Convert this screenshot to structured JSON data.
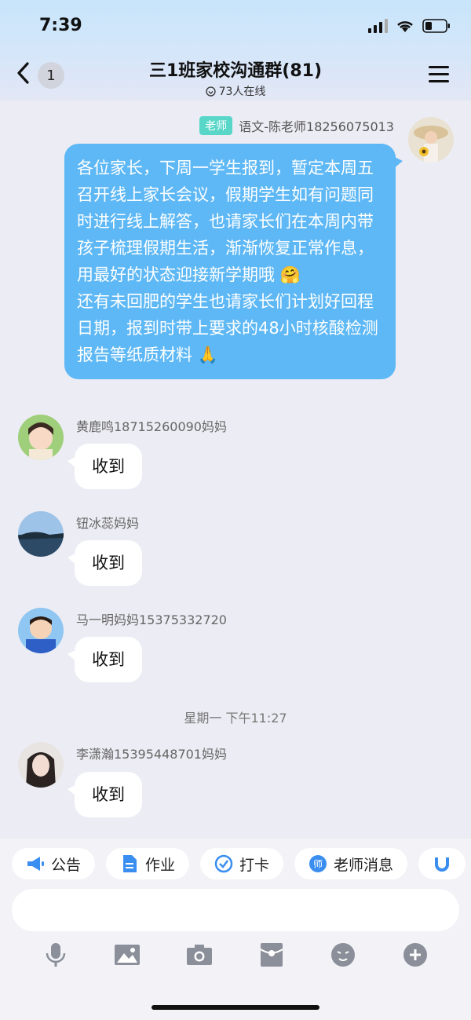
{
  "status": {
    "time": "7:39"
  },
  "header": {
    "back_badge": "1",
    "title": "三1班家校沟通群(81)",
    "online": "73人在线"
  },
  "teacher_message": {
    "tag": "老师",
    "sender": "语文-陈老师18256075013",
    "paragraphs": [
      "各位家长，下周一学生报到，暂定本周五召开线上家长会议，假期学生如有问题同时进行线上解答，也请家长们在本周内带孩子梳理假期生活，渐渐恢复正常作息，用最好的状态迎接新学期哦 🤗",
      "还有未回肥的学生也请家长们计划好回程日期，报到时带上要求的48小时核酸检测报告等纸质材料 🙏"
    ]
  },
  "messages": [
    {
      "sender": "黄鹿鸣18715260090妈妈",
      "text": "收到"
    },
    {
      "sender": "钮冰蕊妈妈",
      "text": "收到"
    },
    {
      "sender": "马一明妈妈15375332720",
      "text": "收到"
    },
    {
      "sender": "李潇瀚15395448701妈妈",
      "text": "收到"
    }
  ],
  "timestamp": "星期一 下午11:27",
  "quick_actions": [
    {
      "label": "公告",
      "icon": "megaphone-icon"
    },
    {
      "label": "作业",
      "icon": "document-icon"
    },
    {
      "label": "打卡",
      "icon": "checkin-icon"
    },
    {
      "label": "老师消息",
      "icon": "teacher-icon"
    }
  ],
  "toolbar_icons": [
    "microphone-icon",
    "image-icon",
    "camera-icon",
    "red-packet-icon",
    "emoji-icon",
    "plus-icon"
  ],
  "colors": {
    "bubble_blue": "#5eb8f5",
    "tag_teal": "#58d6c8",
    "chip_icon_blue": "#3a8ef0"
  }
}
